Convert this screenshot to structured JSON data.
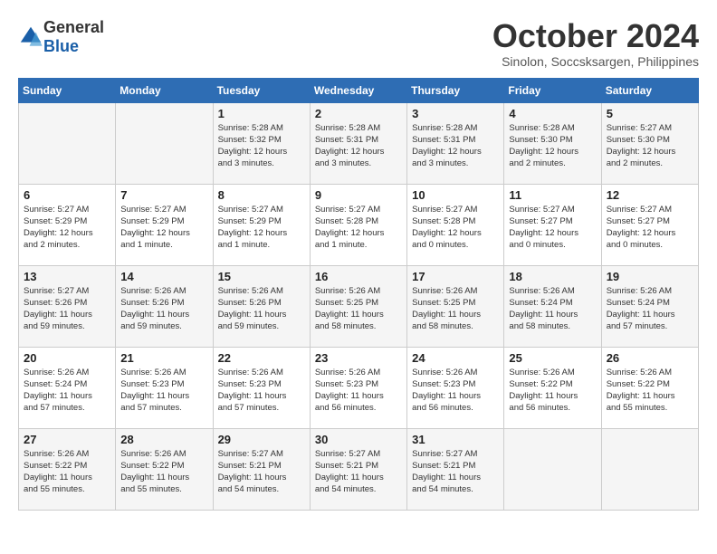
{
  "logo": {
    "general": "General",
    "blue": "Blue"
  },
  "title": "October 2024",
  "subtitle": "Sinolon, Soccsksargen, Philippines",
  "weekdays": [
    "Sunday",
    "Monday",
    "Tuesday",
    "Wednesday",
    "Thursday",
    "Friday",
    "Saturday"
  ],
  "weeks": [
    [
      {
        "day": "",
        "info": ""
      },
      {
        "day": "",
        "info": ""
      },
      {
        "day": "1",
        "info": "Sunrise: 5:28 AM\nSunset: 5:32 PM\nDaylight: 12 hours\nand 3 minutes."
      },
      {
        "day": "2",
        "info": "Sunrise: 5:28 AM\nSunset: 5:31 PM\nDaylight: 12 hours\nand 3 minutes."
      },
      {
        "day": "3",
        "info": "Sunrise: 5:28 AM\nSunset: 5:31 PM\nDaylight: 12 hours\nand 3 minutes."
      },
      {
        "day": "4",
        "info": "Sunrise: 5:28 AM\nSunset: 5:30 PM\nDaylight: 12 hours\nand 2 minutes."
      },
      {
        "day": "5",
        "info": "Sunrise: 5:27 AM\nSunset: 5:30 PM\nDaylight: 12 hours\nand 2 minutes."
      }
    ],
    [
      {
        "day": "6",
        "info": "Sunrise: 5:27 AM\nSunset: 5:29 PM\nDaylight: 12 hours\nand 2 minutes."
      },
      {
        "day": "7",
        "info": "Sunrise: 5:27 AM\nSunset: 5:29 PM\nDaylight: 12 hours\nand 1 minute."
      },
      {
        "day": "8",
        "info": "Sunrise: 5:27 AM\nSunset: 5:29 PM\nDaylight: 12 hours\nand 1 minute."
      },
      {
        "day": "9",
        "info": "Sunrise: 5:27 AM\nSunset: 5:28 PM\nDaylight: 12 hours\nand 1 minute."
      },
      {
        "day": "10",
        "info": "Sunrise: 5:27 AM\nSunset: 5:28 PM\nDaylight: 12 hours\nand 0 minutes."
      },
      {
        "day": "11",
        "info": "Sunrise: 5:27 AM\nSunset: 5:27 PM\nDaylight: 12 hours\nand 0 minutes."
      },
      {
        "day": "12",
        "info": "Sunrise: 5:27 AM\nSunset: 5:27 PM\nDaylight: 12 hours\nand 0 minutes."
      }
    ],
    [
      {
        "day": "13",
        "info": "Sunrise: 5:27 AM\nSunset: 5:26 PM\nDaylight: 11 hours\nand 59 minutes."
      },
      {
        "day": "14",
        "info": "Sunrise: 5:26 AM\nSunset: 5:26 PM\nDaylight: 11 hours\nand 59 minutes."
      },
      {
        "day": "15",
        "info": "Sunrise: 5:26 AM\nSunset: 5:26 PM\nDaylight: 11 hours\nand 59 minutes."
      },
      {
        "day": "16",
        "info": "Sunrise: 5:26 AM\nSunset: 5:25 PM\nDaylight: 11 hours\nand 58 minutes."
      },
      {
        "day": "17",
        "info": "Sunrise: 5:26 AM\nSunset: 5:25 PM\nDaylight: 11 hours\nand 58 minutes."
      },
      {
        "day": "18",
        "info": "Sunrise: 5:26 AM\nSunset: 5:24 PM\nDaylight: 11 hours\nand 58 minutes."
      },
      {
        "day": "19",
        "info": "Sunrise: 5:26 AM\nSunset: 5:24 PM\nDaylight: 11 hours\nand 57 minutes."
      }
    ],
    [
      {
        "day": "20",
        "info": "Sunrise: 5:26 AM\nSunset: 5:24 PM\nDaylight: 11 hours\nand 57 minutes."
      },
      {
        "day": "21",
        "info": "Sunrise: 5:26 AM\nSunset: 5:23 PM\nDaylight: 11 hours\nand 57 minutes."
      },
      {
        "day": "22",
        "info": "Sunrise: 5:26 AM\nSunset: 5:23 PM\nDaylight: 11 hours\nand 57 minutes."
      },
      {
        "day": "23",
        "info": "Sunrise: 5:26 AM\nSunset: 5:23 PM\nDaylight: 11 hours\nand 56 minutes."
      },
      {
        "day": "24",
        "info": "Sunrise: 5:26 AM\nSunset: 5:23 PM\nDaylight: 11 hours\nand 56 minutes."
      },
      {
        "day": "25",
        "info": "Sunrise: 5:26 AM\nSunset: 5:22 PM\nDaylight: 11 hours\nand 56 minutes."
      },
      {
        "day": "26",
        "info": "Sunrise: 5:26 AM\nSunset: 5:22 PM\nDaylight: 11 hours\nand 55 minutes."
      }
    ],
    [
      {
        "day": "27",
        "info": "Sunrise: 5:26 AM\nSunset: 5:22 PM\nDaylight: 11 hours\nand 55 minutes."
      },
      {
        "day": "28",
        "info": "Sunrise: 5:26 AM\nSunset: 5:22 PM\nDaylight: 11 hours\nand 55 minutes."
      },
      {
        "day": "29",
        "info": "Sunrise: 5:27 AM\nSunset: 5:21 PM\nDaylight: 11 hours\nand 54 minutes."
      },
      {
        "day": "30",
        "info": "Sunrise: 5:27 AM\nSunset: 5:21 PM\nDaylight: 11 hours\nand 54 minutes."
      },
      {
        "day": "31",
        "info": "Sunrise: 5:27 AM\nSunset: 5:21 PM\nDaylight: 11 hours\nand 54 minutes."
      },
      {
        "day": "",
        "info": ""
      },
      {
        "day": "",
        "info": ""
      }
    ]
  ]
}
